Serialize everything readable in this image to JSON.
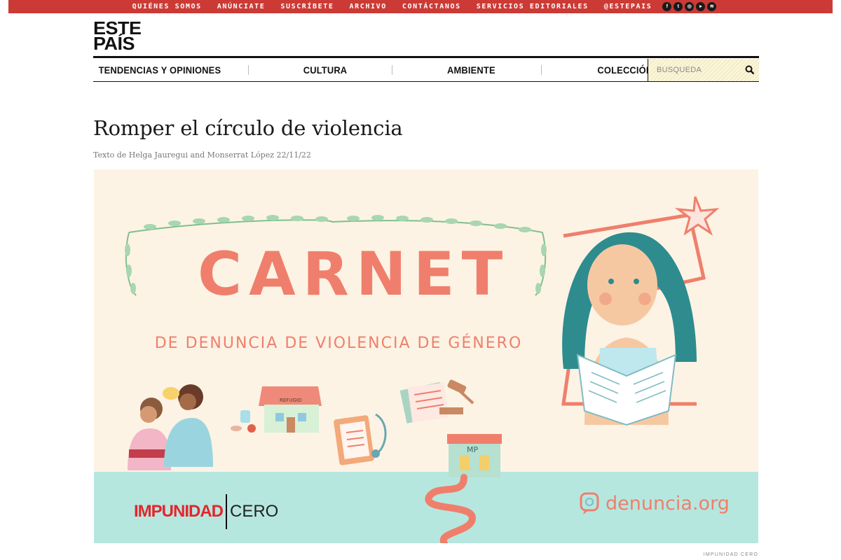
{
  "topbar": {
    "links": [
      "QUIÉNES SOMOS",
      "ANÚNCIATE",
      "SUSCRÍBETE",
      "ARCHIVO",
      "CONTÁCTANOS",
      "SERVICIOS EDITORIALES",
      "@ESTEPAIS"
    ],
    "social_icons": [
      "facebook-icon",
      "twitter-icon",
      "instagram-icon",
      "youtube-icon",
      "spotify-icon"
    ],
    "color": "#cc3a35"
  },
  "logo": {
    "line1": "ESTE",
    "line2": "PAÍS"
  },
  "nav": {
    "items": [
      "TENDENCIAS Y OPINIONES",
      "CULTURA",
      "AMBIENTE",
      "COLECCIÓN"
    ],
    "search_placeholder": "BÚSQUEDA"
  },
  "article": {
    "title": "Romper el círculo de violencia",
    "byline": "Texto de Helga Jauregui and Monserrat López 22/11/22",
    "image": {
      "headline": "CARNET",
      "subheadline": "DE DENUNCIA DE VIOLENCIA DE GÉNERO",
      "brand_left_a": "IMPUNIDAD",
      "brand_left_b": "CERO",
      "brand_right": "denuncia.org",
      "sign_house": "REFUGIO",
      "sign_building": "MP",
      "accent_color": "#ef7f6c",
      "footer_color": "#b6e7df"
    },
    "caption": "IMPUNIDAD CERO"
  }
}
